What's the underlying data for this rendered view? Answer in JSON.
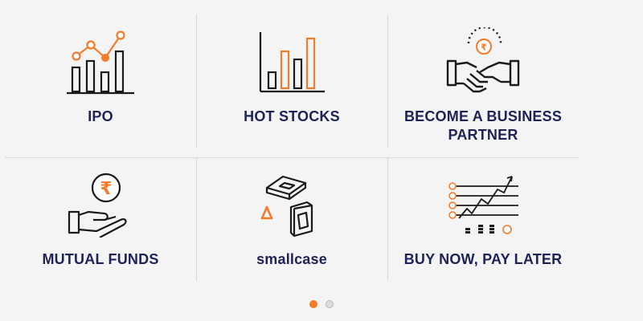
{
  "theme": {
    "accent": "#f47b2a",
    "text": "#1d2356",
    "stroke": "#1a1a1a",
    "divider": "#d8d8d8",
    "dot_inactive": "#dddddd"
  },
  "tiles": [
    {
      "label_lines": [
        "IPO"
      ],
      "icon": "line-chart-growth-icon"
    },
    {
      "label_lines": [
        "HOT STOCKS"
      ],
      "icon": "bar-chart-icon"
    },
    {
      "label_lines": [
        "BECOME A BUSINESS",
        "PARTNER"
      ],
      "icon": "handshake-rupee-icon"
    },
    {
      "label_lines": [
        "MUTUAL FUNDS"
      ],
      "icon": "hand-rupee-coin-icon"
    },
    {
      "label_lines": [
        "smallcase"
      ],
      "icon": "smallcase-cube-icon"
    },
    {
      "label_lines": [
        "BUY NOW, PAY LATER"
      ],
      "icon": "trend-coins-chart-icon"
    }
  ],
  "carousel": {
    "pages": 2,
    "active_index": 0
  }
}
